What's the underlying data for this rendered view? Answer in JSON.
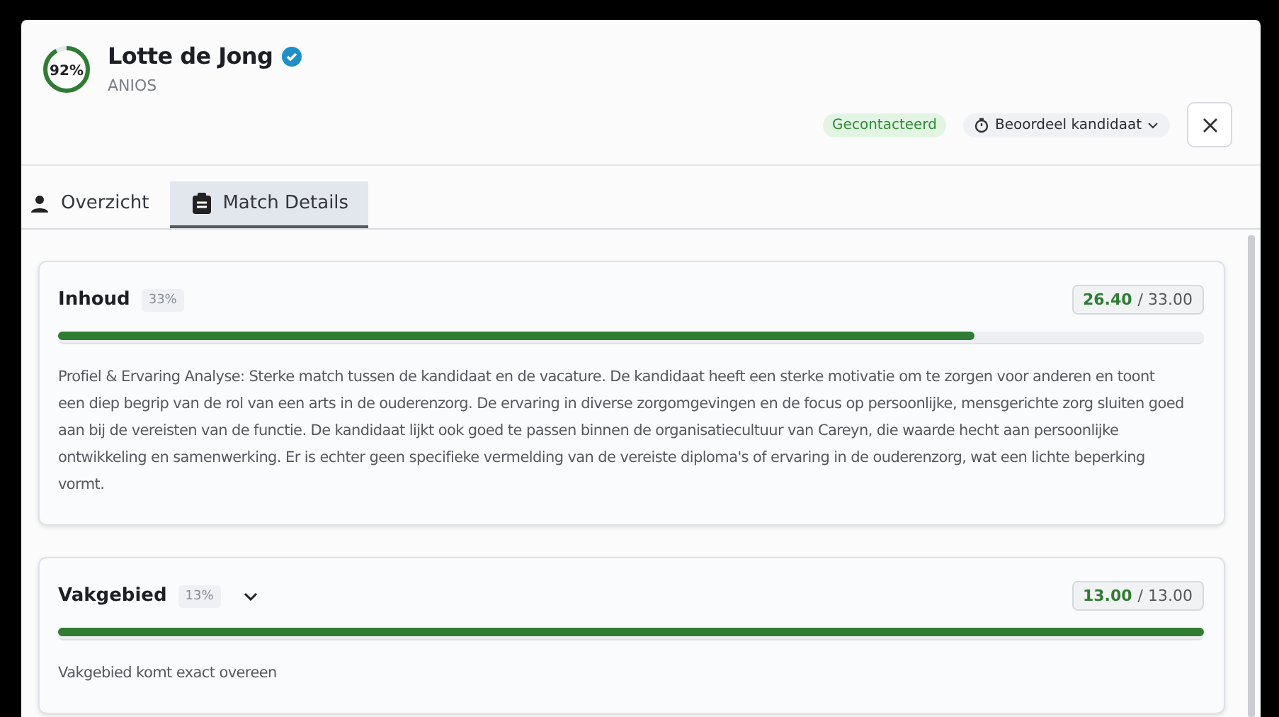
{
  "candidate": {
    "match": "92%",
    "level": 0.92,
    "name": "Lotte de Jong",
    "verified": true,
    "role": "ANIOS"
  },
  "status_badge": "Gecontacteerd",
  "rate_button": "Beoordeel kandidaat",
  "tabs": [
    {
      "label": "Overzicht",
      "selected": false
    },
    {
      "label": "Match Details",
      "selected": true
    }
  ],
  "sections": [
    {
      "title": "Inhoud",
      "weight": "33%",
      "expandable": false,
      "score": "26.40",
      "max": "/ 33.00",
      "level": 0.8,
      "text": "Profiel & Ervaring Analyse: Sterke match tussen de kandidaat en de vacature. De kandidaat heeft een sterke motivatie om te zorgen voor anderen en toont een diep begrip van de rol van een arts in de ouderenzorg. De ervaring in diverse zorgomgevingen en de focus op persoonlijke, mensgerichte zorg sluiten goed aan bij de vereisten van de functie. De kandidaat lijkt ook goed te passen binnen de organisatiecultuur van Careyn, die waarde hecht aan persoonlijke ontwikkeling en samenwerking. Er is echter geen specifieke vermelding van de vereiste diploma's of ervaring in de ouderenzorg, wat een lichte beperking vormt."
    },
    {
      "title": "Vakgebied",
      "weight": "13%",
      "expandable": true,
      "score": "13.00",
      "max": "/ 13.00",
      "level": 1,
      "text": "Vakgebied komt exact overeen"
    }
  ]
}
